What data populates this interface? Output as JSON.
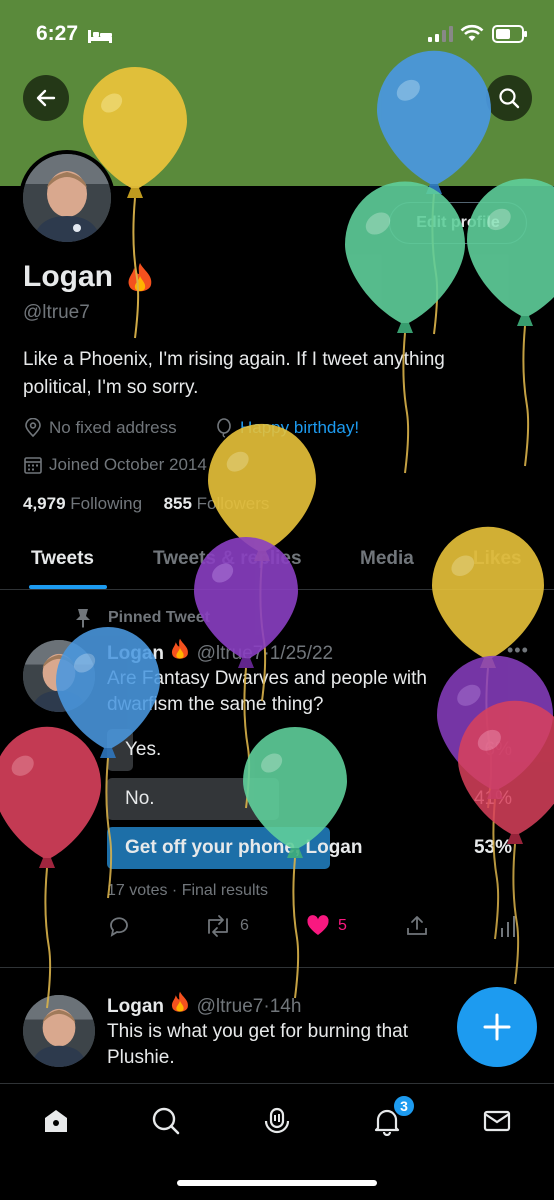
{
  "status_bar": {
    "time": "6:27"
  },
  "profile": {
    "edit_label": "Edit profile",
    "name": "Logan",
    "handle": "@ltrue7",
    "bio_line1": "Like a Phoenix, I'm rising again. If I tweet anything",
    "bio_line2": "political, I'm so sorry.",
    "location": "No fixed address",
    "birthday": "Happy birthday!",
    "joined": "Joined October 2014",
    "following_count": "4,979",
    "following_label": "Following",
    "followers_count": "855",
    "followers_label": "Followers"
  },
  "tabs": [
    {
      "label": "Tweets"
    },
    {
      "label": "Tweets & replies"
    },
    {
      "label": "Media"
    },
    {
      "label": "Likes"
    }
  ],
  "pinned_tweet": {
    "pinned_label": "Pinned Tweet",
    "name": "Logan",
    "handle": "@ltrue7",
    "sep": "·",
    "date": "1/25/22",
    "text_line1": "Are Fantasy Dwarves and people with",
    "text_line2": "dwarfism the same thing?",
    "poll": [
      {
        "label": "Yes.",
        "pct": "6%",
        "fraction": 0.06
      },
      {
        "label": "No.",
        "pct": "41%",
        "fraction": 0.41
      },
      {
        "label": "Get off your phone, Logan",
        "pct": "53%",
        "fraction": 0.53
      }
    ],
    "poll_meta": "17 votes · Final results",
    "retweets": "6",
    "likes": "5"
  },
  "second_tweet": {
    "name": "Logan",
    "handle": "@ltrue7",
    "sep": "·",
    "time": "14h",
    "text_line1": "This is what you get for burning that",
    "text_line2": "Plushie."
  },
  "bottom_nav": {
    "notifications_badge": "3"
  },
  "colors": {
    "accent": "#1d9bf0",
    "banner": "#5a8a3b",
    "like": "#f91880"
  }
}
